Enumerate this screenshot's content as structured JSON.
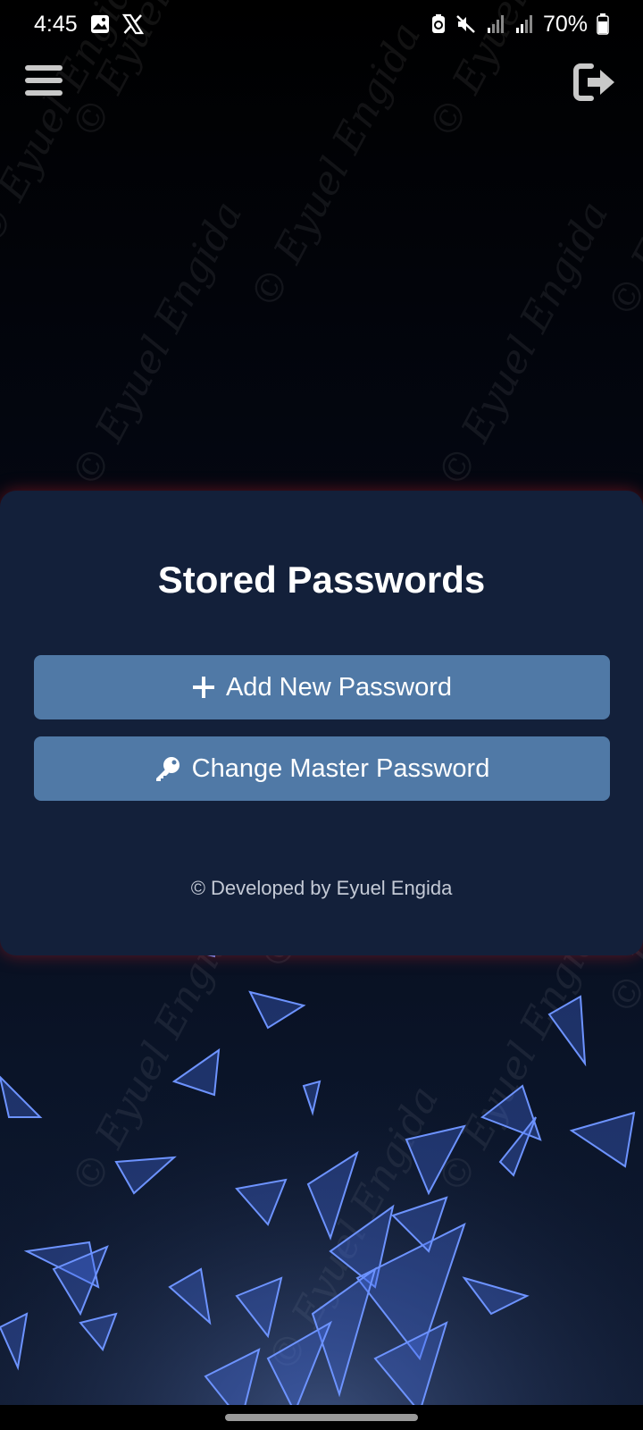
{
  "status_bar": {
    "time": "4:45",
    "battery": "70%",
    "icons": [
      "image-icon",
      "x-logo-icon",
      "battery-saver-icon",
      "mute-icon",
      "signal-icon",
      "signal-icon",
      "battery-icon"
    ]
  },
  "toolbar": {
    "menu_icon": "hamburger-menu-icon",
    "logout_icon": "logout-icon"
  },
  "watermark": "© Eyuel Engida",
  "card": {
    "title": "Stored Passwords",
    "add_button": {
      "icon": "plus-icon",
      "label": "Add New Password"
    },
    "change_button": {
      "icon": "key-icon",
      "label": "Change Master Password"
    },
    "credit": "© Developed by Eyuel Engida"
  },
  "colors": {
    "card_bg": "#13203a",
    "button_bg": "#5079a6",
    "glow": "#aa1e28",
    "shards": "#4d7dff"
  }
}
